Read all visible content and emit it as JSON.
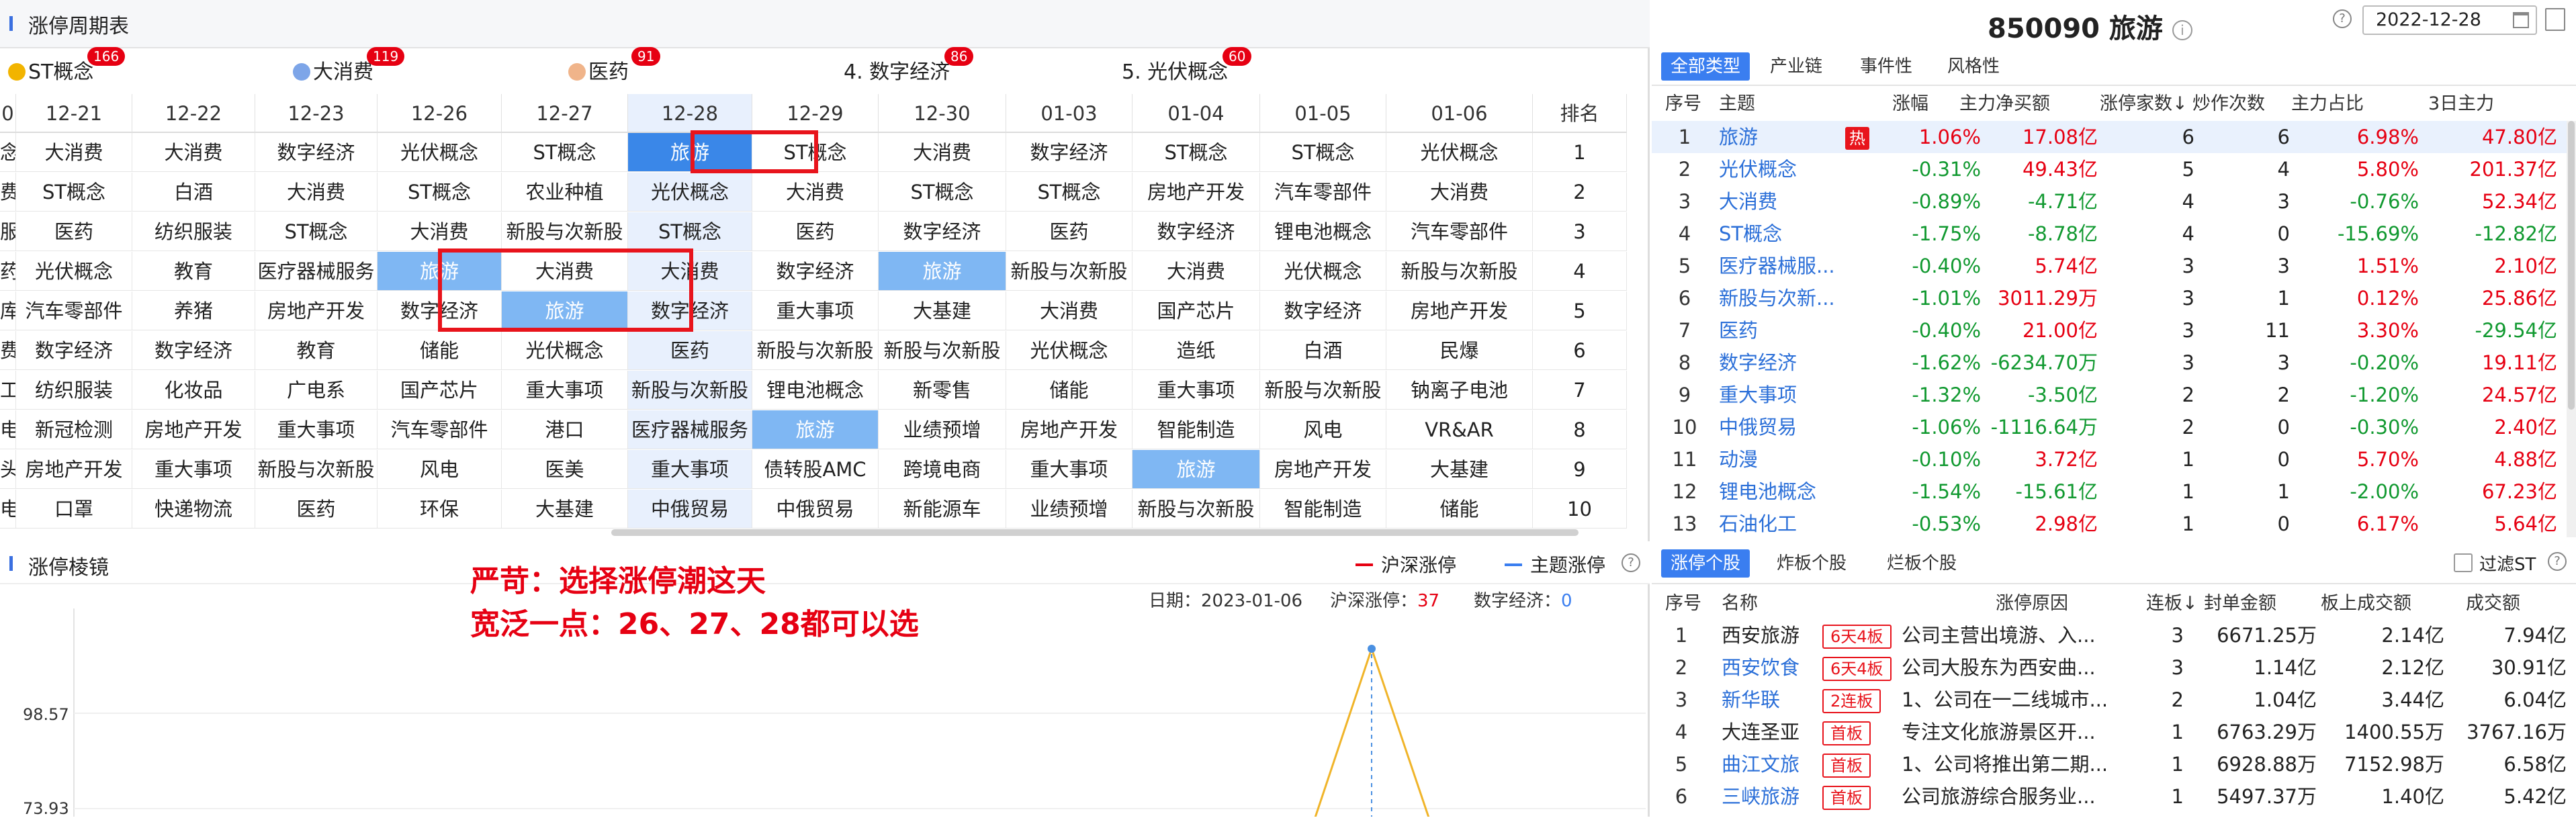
{
  "top_panel": {
    "title": "涨停周期表",
    "concepts": [
      {
        "label": "ST概念",
        "badge": "166",
        "icon": "gold-coin-icon",
        "color": "#f2b400"
      },
      {
        "label": "大消费",
        "badge": "119",
        "icon": "blue-globe-icon",
        "color": "#7da5e8"
      },
      {
        "label": "医药",
        "badge": "91",
        "icon": "peach-ball-icon",
        "color": "#f0b48a"
      },
      {
        "label": "4. 数字经济",
        "badge": "86"
      },
      {
        "label": "5. 光伏概念",
        "badge": "60"
      }
    ],
    "headers": [
      "0",
      "12-21",
      "12-22",
      "12-23",
      "12-26",
      "12-27",
      "12-28",
      "12-29",
      "12-30",
      "01-03",
      "01-04",
      "01-05",
      "01-06",
      "排名"
    ],
    "rows": [
      [
        "念",
        "大消费",
        "大消费",
        "数字经济",
        "光伏概念",
        "ST概念",
        "旅游",
        "ST概念",
        "大消费",
        "数字经济",
        "ST概念",
        "ST概念",
        "光伏概念",
        "1"
      ],
      [
        "费",
        "ST概念",
        "白酒",
        "大消费",
        "ST概念",
        "农业种植",
        "光伏概念",
        "大消费",
        "ST概念",
        "ST概念",
        "房地产开发",
        "汽车零部件",
        "大消费",
        "2"
      ],
      [
        "服装",
        "医药",
        "纺织服装",
        "ST概念",
        "大消费",
        "新股与次新股",
        "ST概念",
        "医药",
        "数字经济",
        "医药",
        "数字经济",
        "锂电池概念",
        "汽车零部件",
        "3"
      ],
      [
        "药",
        "光伏概念",
        "教育",
        "医疗器械服务",
        "旅游",
        "大消费",
        "大消费",
        "数字经济",
        "旅游",
        "新股与次新股",
        "大消费",
        "光伏概念",
        "新股与次新股",
        "4"
      ],
      [
        "库车",
        "汽车零部件",
        "养猪",
        "房地产开发",
        "数字经济",
        "旅游",
        "数字经济",
        "重大事项",
        "大基建",
        "大消费",
        "国产芯片",
        "数字经济",
        "房地产开发",
        "5"
      ],
      [
        "费",
        "数字经济",
        "数字经济",
        "教育",
        "储能",
        "光伏概念",
        "医药",
        "新股与次新股",
        "新股与次新股",
        "光伏概念",
        "造纸",
        "白酒",
        "民爆",
        "6"
      ],
      [
        "工",
        "纺织服装",
        "化妆品",
        "广电系",
        "国产芯片",
        "重大事项",
        "新股与次新股",
        "锂电池概念",
        "新零售",
        "储能",
        "重大事项",
        "新股与次新股",
        "钠离子电池",
        "7"
      ],
      [
        "电池",
        "新冠检测",
        "房地产开发",
        "重大事项",
        "汽车零部件",
        "港口",
        "医疗器械服务",
        "旅游",
        "业绩预增",
        "房地产开发",
        "智能制造",
        "风电",
        "VR&AR",
        "8"
      ],
      [
        "头",
        "房地产开发",
        "重大事项",
        "新股与次新股",
        "风电",
        "医美",
        "重大事项",
        "债转股AMC",
        "跨境电商",
        "重大事项",
        "旅游",
        "房地产开发",
        "大基建",
        "9"
      ],
      [
        "电",
        "口罩",
        "快递物流",
        "医药",
        "环保",
        "大基建",
        "中俄贸易",
        "中俄贸易",
        "新能源车",
        "业绩预增",
        "新股与次新股",
        "智能制造",
        "储能",
        "10"
      ]
    ]
  },
  "right_panel": {
    "stock_title": "850090 旅游",
    "date": "2022-12-28",
    "tabs": [
      "全部类型",
      "产业链",
      "事件性",
      "风格性"
    ],
    "headers": [
      "序号",
      "主题",
      "涨幅",
      "主力净买额",
      "涨停家数↓",
      "炒作次数",
      "主力占比",
      "3日主力"
    ],
    "hot_label": "热",
    "rows": [
      {
        "no": "1",
        "name": "旅游",
        "chg": "1.06%",
        "net": "17.08亿",
        "limit": "6",
        "times": "6",
        "ratio": "6.98%",
        "d3": "47.80亿"
      },
      {
        "no": "2",
        "name": "光伏概念",
        "chg": "-0.31%",
        "net": "49.43亿",
        "limit": "5",
        "times": "4",
        "ratio": "5.80%",
        "d3": "201.37亿"
      },
      {
        "no": "3",
        "name": "大消费",
        "chg": "-0.89%",
        "net": "-4.71亿",
        "limit": "4",
        "times": "3",
        "ratio": "-0.76%",
        "d3": "52.34亿"
      },
      {
        "no": "4",
        "name": "ST概念",
        "chg": "-1.75%",
        "net": "-8.78亿",
        "limit": "4",
        "times": "0",
        "ratio": "-15.69%",
        "d3": "-12.82亿"
      },
      {
        "no": "5",
        "name": "医疗器械服...",
        "chg": "-0.40%",
        "net": "5.74亿",
        "limit": "3",
        "times": "3",
        "ratio": "1.51%",
        "d3": "2.10亿"
      },
      {
        "no": "6",
        "name": "新股与次新...",
        "chg": "-1.01%",
        "net": "3011.29万",
        "limit": "3",
        "times": "1",
        "ratio": "0.12%",
        "d3": "25.86亿"
      },
      {
        "no": "7",
        "name": "医药",
        "chg": "-0.40%",
        "net": "21.00亿",
        "limit": "3",
        "times": "11",
        "ratio": "3.30%",
        "d3": "-29.54亿"
      },
      {
        "no": "8",
        "name": "数字经济",
        "chg": "-1.62%",
        "net": "-6234.70万",
        "limit": "3",
        "times": "3",
        "ratio": "-0.20%",
        "d3": "19.11亿"
      },
      {
        "no": "9",
        "name": "重大事项",
        "chg": "-1.32%",
        "net": "-3.50亿",
        "limit": "2",
        "times": "2",
        "ratio": "-1.20%",
        "d3": "24.57亿"
      },
      {
        "no": "10",
        "name": "中俄贸易",
        "chg": "-1.06%",
        "net": "-1116.64万",
        "limit": "2",
        "times": "0",
        "ratio": "-0.30%",
        "d3": "2.40亿"
      },
      {
        "no": "11",
        "name": "动漫",
        "chg": "-0.10%",
        "net": "3.72亿",
        "limit": "1",
        "times": "0",
        "ratio": "5.70%",
        "d3": "4.88亿"
      },
      {
        "no": "12",
        "name": "锂电池概念",
        "chg": "-1.54%",
        "net": "-15.61亿",
        "limit": "1",
        "times": "1",
        "ratio": "-2.00%",
        "d3": "67.23亿"
      },
      {
        "no": "13",
        "name": "石油化工",
        "chg": "-0.53%",
        "net": "2.98亿",
        "limit": "1",
        "times": "0",
        "ratio": "6.17%",
        "d3": "5.64亿"
      }
    ]
  },
  "bottom_left": {
    "title": "涨停棱镜",
    "legend_hs": "沪深涨停",
    "legend_theme": "主题涨停",
    "annotation_line1": "严苛：选择涨停潮这天",
    "annotation_line2": "宽泛一点：26、27、28都可以选",
    "date_label": "日期：2023-01-06",
    "hs_label": "沪深涨停：",
    "hs_value": "37",
    "de_label": "数字经济：",
    "de_value": "0",
    "y_ticks": [
      "98.57",
      "73.93"
    ],
    "colors": {
      "hs": "#e60012",
      "theme": "#3a7ef0",
      "line": "#f0b429"
    }
  },
  "bottom_right": {
    "tabs": [
      "涨停个股",
      "炸板个股",
      "烂板个股"
    ],
    "filter_label": "过滤ST",
    "headers": [
      "序号",
      "名称",
      "涨停原因",
      "连板↓",
      "封单金额",
      "板上成交额",
      "成交额"
    ],
    "rows": [
      {
        "no": "1",
        "name": "西安旅游",
        "tag": "6天4板",
        "reason": "公司主营出境游、入...",
        "lb": "3",
        "seal": "6671.25万",
        "board": "2.14亿",
        "amt": "7.94亿"
      },
      {
        "no": "2",
        "name": "西安饮食",
        "tag": "6天4板",
        "reason": "公司大股东为西安曲...",
        "lb": "3",
        "seal": "1.14亿",
        "board": "2.12亿",
        "amt": "30.91亿"
      },
      {
        "no": "3",
        "name": "新华联",
        "tag": "2连板",
        "reason": "1、公司在一二线城市...",
        "lb": "2",
        "seal": "1.04亿",
        "board": "3.44亿",
        "amt": "6.04亿"
      },
      {
        "no": "4",
        "name": "大连圣亚",
        "tag": "首板",
        "reason": "专注文化旅游景区开...",
        "lb": "1",
        "seal": "6763.29万",
        "board": "1400.55万",
        "amt": "3767.16万"
      },
      {
        "no": "5",
        "name": "曲江文旅",
        "tag": "首板",
        "reason": "1、公司将推出第二期...",
        "lb": "1",
        "seal": "6928.88万",
        "board": "7152.98万",
        "amt": "6.58亿"
      },
      {
        "no": "6",
        "name": "三峡旅游",
        "tag": "首板",
        "reason": "公司旅游综合服务业...",
        "lb": "1",
        "seal": "5497.37万",
        "board": "1.40亿",
        "amt": "5.42亿"
      }
    ]
  }
}
